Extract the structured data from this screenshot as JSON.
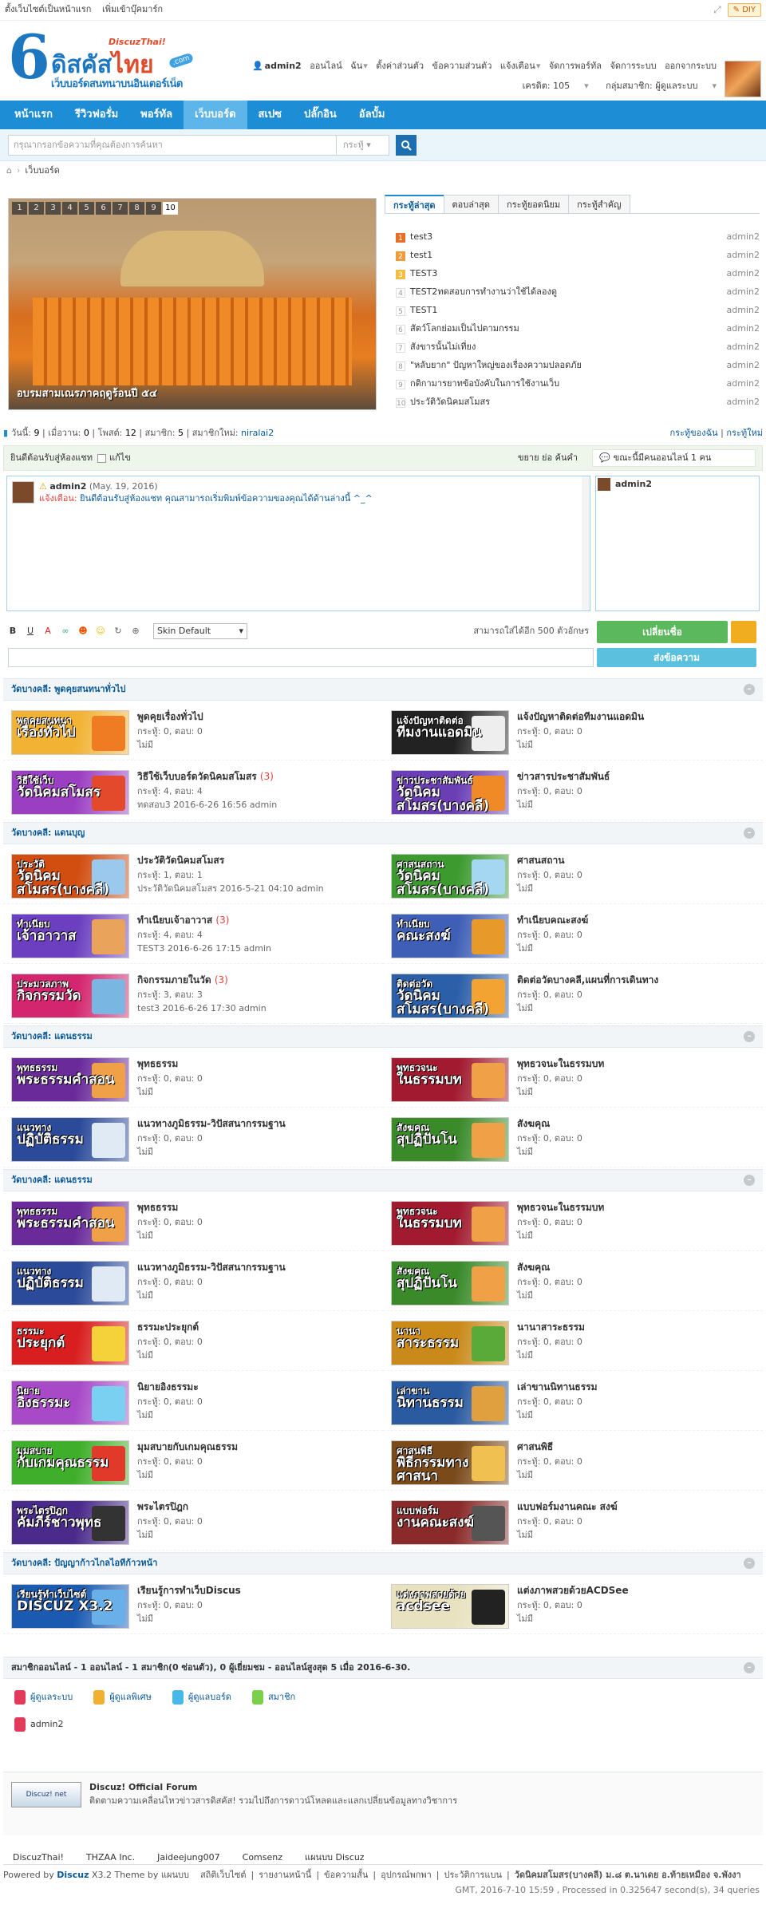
{
  "topbar": {
    "set_home": "ตั้งเว็บไซต์เป็นหน้าแรก",
    "bookmark": "เพิ่มเข้าบุ๊คมาร์ก",
    "diy": "DIY"
  },
  "logo": {
    "digit": "6",
    "title_a": "ดิสคัส",
    "title_b": "ไทย",
    "subtitle": "เว็บบอร์ดสนทนาบนอินเตอร์เน็ต",
    "tag": "DiscuzThai!",
    "com": ".com"
  },
  "user": {
    "name": "admin2",
    "online": "ออนไลน์",
    "menu": [
      "ฉัน",
      "ตั้งค่าส่วนตัว",
      "ข้อความส่วนตัว",
      "แจ้งเตือน",
      "จัดการพอร์ทัล",
      "จัดการระบบ",
      "ออกจากระบบ"
    ],
    "credit": "เครดิต: 105",
    "group": "กลุ่มสมาชิก: ผู้ดูแลระบบ"
  },
  "nav": [
    "หน้าแรก",
    "รีวิวฟอรั่ม",
    "พอร์ทัล",
    "เว็บบอร์ด",
    "สเปซ",
    "ปลั๊กอิน",
    "อัลบั้ม"
  ],
  "search": {
    "placeholder": "กรุณากรอกข้อความที่คุณต้องการค้นหา",
    "scope": "กระทู้"
  },
  "breadcrumb": "เว็บบอร์ด",
  "slideshow": {
    "pages": [
      "1",
      "2",
      "3",
      "4",
      "5",
      "6",
      "7",
      "8",
      "9",
      "10"
    ],
    "active": "10",
    "caption": "อบรมสามเณรภาคฤดูร้อนปี ๕๔"
  },
  "tabs": [
    "กระทู้ล่าสุด",
    "ตอบล่าสุด",
    "กระทู้ยอดนิยม",
    "กระทู้สำคัญ"
  ],
  "latest": [
    {
      "n": "1",
      "title": "test3",
      "author": "admin2"
    },
    {
      "n": "2",
      "title": "test1",
      "author": "admin2"
    },
    {
      "n": "3",
      "title": "TEST3",
      "author": "admin2"
    },
    {
      "n": "4",
      "title": "TEST2ทดสอบการทำงานว่าใช้ได้ลองดู",
      "author": "admin2"
    },
    {
      "n": "5",
      "title": "TEST1",
      "author": "admin2"
    },
    {
      "n": "6",
      "title": "สัตว์โลกย่อมเป็นไปตามกรรม",
      "author": "admin2"
    },
    {
      "n": "7",
      "title": "สังขารนั้นไม่เที่ยง",
      "author": "admin2"
    },
    {
      "n": "8",
      "title": "\"หลับยาก\" ปัญหาใหญ่ของเรื่องความปลอดภัย",
      "author": "admin2"
    },
    {
      "n": "9",
      "title": "กติกามารยาทข้อบังคับในการใช้งานเว็บ",
      "author": "admin2"
    },
    {
      "n": "10",
      "title": "ประวัติวัดนิคมสโมสร",
      "author": "admin2"
    }
  ],
  "stats": {
    "today_l": "วันนี้:",
    "today": "9",
    "yesterday_l": "เมื่อวาน:",
    "yesterday": "0",
    "posts_l": "โพสต์:",
    "posts": "12",
    "members_l": "สมาชิก:",
    "members": "5",
    "newest_l": "สมาชิกใหม่:",
    "newest": "niralai2",
    "my_threads": "กระทู้ของฉัน",
    "my_posts": "กระทู้ใหม่"
  },
  "chat": {
    "welcome": "ยินดีต้อนรับสู่ห้องแชท",
    "fix": "แก้ไข",
    "size": "ขยาย ย่อ ค้นคำ",
    "online": "ขณะนี้มีคนออนไลน์ 1 คน",
    "msg_user": "admin2",
    "msg_date": "(May. 19, 2016)",
    "msg_label": "แจ้งเตือน:",
    "msg_text": "ยินดีต้อนรับสู่ห้องแชท คุณสามารถเริ่มพิมพ์ข้อความของคุณได้ด้านล่างนี้ ^_^",
    "online_user": "admin2",
    "skin": "Skin Default",
    "remain": "สามารถใส่ได้อีก 500 ตัวอักษร",
    "change_name": "เปลี่ยนชื่อ",
    "send": "ส่งข้อความ"
  },
  "sections": [
    {
      "title": "วัดบางคลี: พูดคุยสนทนาทั่วไป",
      "forums": [
        {
          "name": "พูดคุยเรื่องทั่วไป",
          "new": "",
          "meta1": "กระทู้: 0, ตอบ: 0",
          "meta2": "ไม่มี",
          "b1": "พูดคุยสนทนา",
          "b2": "เรื่องทั่วไป",
          "bg": "#f2b233",
          "art": "#ef7b22"
        },
        {
          "name": "แจ้งปัญหาติดต่อทีมงานแอดมิน",
          "new": "",
          "meta1": "กระทู้: 0, ตอบ: 0",
          "meta2": "ไม่มี",
          "b1": "แจ้งปัญหาติดต่อ",
          "b2": "ทีมงานแอดมิน",
          "bg": "#222",
          "art": "#eee"
        },
        {
          "name": "วิธีใช้เว็บบอร์ดวัดนิคมสโมสร",
          "new": "(3)",
          "meta1": "กระทู้: 4, ตอบ: 4",
          "meta2": "ทดสอบ3 2016-6-26 16:56 admin",
          "b1": "วิธีใช้เว็บ",
          "b2": "วัดนิคมสโมสร",
          "bg": "#9b3fc2",
          "art": "#e24a2b"
        },
        {
          "name": "ข่าวสารประชาสัมพันธ์",
          "new": "",
          "meta1": "กระทู้: 0, ตอบ: 0",
          "meta2": "ไม่มี",
          "b1": "ข่าวประชาสัมพันธ์",
          "b2": "วัดนิคมสโมสร(บางคลี)",
          "bg": "#6a3fb5",
          "art": "#ef8a26"
        }
      ]
    },
    {
      "title": "วัดบางคลี: แดนบุญ",
      "forums": [
        {
          "name": "ประวัติวัดนิคมสโมสร",
          "new": "",
          "meta1": "กระทู้: 1, ตอบ: 1",
          "meta2": "ประวัติวัดนิคมสโมสร 2016-5-21 04:10 admin",
          "b1": "ประวัติ",
          "b2": "วัดนิคมสโมสร(บางคลี)",
          "bg": "#d14d10",
          "art": "#9bc9ee"
        },
        {
          "name": "ศาสนสถาน",
          "new": "",
          "meta1": "กระทู้: 0, ตอบ: 0",
          "meta2": "ไม่มี",
          "b1": "ศาสนสถาน",
          "b2": "วัดนิคมสโมสร(บางคลี)",
          "bg": "#3c9a2f",
          "art": "#a6d7f2"
        },
        {
          "name": "ทำเนียบเจ้าอาวาส",
          "new": "(3)",
          "meta1": "กระทู้: 4, ตอบ: 4",
          "meta2": "TEST3 2016-6-26 17:15 admin",
          "b1": "ทำเนียบ",
          "b2": "เจ้าอาวาส",
          "bg": "#6b3fc0",
          "art": "#e9a35a"
        },
        {
          "name": "ทำเนียบคณะสงฆ์",
          "new": "",
          "meta1": "กระทู้: 0, ตอบ: 0",
          "meta2": "ไม่มี",
          "b1": "ทำเนียบ",
          "b2": "คณะสงฆ์",
          "bg": "#3f5fb6",
          "art": "#e79a2a"
        },
        {
          "name": "กิจกรรมภายในวัด",
          "new": "(3)",
          "meta1": "กระทู้: 3, ตอบ: 3",
          "meta2": "test3 2016-6-26 17:30 admin",
          "b1": "ประมวลภาพ",
          "b2": "กิจกรรมวัด",
          "bg": "#d4266e",
          "art": "#7ab6e2"
        },
        {
          "name": "ติดต่อวัดบางคลี,แผนที่การเดินทาง",
          "new": "",
          "meta1": "กระทู้: 0, ตอบ: 0",
          "meta2": "ไม่มี",
          "b1": "ติดต่อวัด",
          "b2": "วัดนิคมสโมสร(บางคลี)",
          "bg": "#2b5fa8",
          "art": "#f2a331"
        }
      ]
    },
    {
      "title": "วัดบางคลี: แดนธรรม",
      "forums": [
        {
          "name": "พุทธธรรม",
          "new": "",
          "meta1": "กระทู้: 0, ตอบ: 0",
          "meta2": "ไม่มี",
          "b1": "พุทธธรรม",
          "b2": "พระธรรมคำสอน",
          "bg": "#6a2a9a",
          "art": "#f0a046"
        },
        {
          "name": "พุทธวจนะในธรรมบท",
          "new": "",
          "meta1": "กระทู้: 0, ตอบ: 0",
          "meta2": "ไม่มี",
          "b1": "พุทธวจนะ",
          "b2": "ในธรรมบท",
          "bg": "#a11a2f",
          "art": "#f0a046"
        },
        {
          "name": "แนวทางภูมิธรรม-วิปัสสนากรรมฐาน",
          "new": "",
          "meta1": "กระทู้: 0, ตอบ: 0",
          "meta2": "ไม่มี",
          "b1": "แนวทาง",
          "b2": "ปฏิบัติธรรม",
          "bg": "#2b4a9a",
          "art": "#dfeaf5"
        },
        {
          "name": "สังฆคุณ",
          "new": "",
          "meta1": "กระทู้: 0, ตอบ: 0",
          "meta2": "ไม่มี",
          "b1": "สังฆคุณ",
          "b2": "สุปฏิปันโน",
          "bg": "#3a8a2a",
          "art": "#f0a046"
        }
      ]
    },
    {
      "title": "วัดบางคลี: แดนธรรม",
      "forums": [
        {
          "name": "พุทธธรรม",
          "new": "",
          "meta1": "กระทู้: 0, ตอบ: 0",
          "meta2": "ไม่มี",
          "b1": "พุทธธรรม",
          "b2": "พระธรรมคำสอน",
          "bg": "#6a2a9a",
          "art": "#f0a046"
        },
        {
          "name": "พุทธวจนะในธรรมบท",
          "new": "",
          "meta1": "กระทู้: 0, ตอบ: 0",
          "meta2": "ไม่มี",
          "b1": "พุทธวจนะ",
          "b2": "ในธรรมบท",
          "bg": "#a11a2f",
          "art": "#f0a046"
        },
        {
          "name": "แนวทางภูมิธรรม-วิปัสสนากรรมฐาน",
          "new": "",
          "meta1": "กระทู้: 0, ตอบ: 0",
          "meta2": "ไม่มี",
          "b1": "แนวทาง",
          "b2": "ปฏิบัติธรรม",
          "bg": "#2b4a9a",
          "art": "#dfeaf5"
        },
        {
          "name": "สังฆคุณ",
          "new": "",
          "meta1": "กระทู้: 0, ตอบ: 0",
          "meta2": "ไม่มี",
          "b1": "สังฆคุณ",
          "b2": "สุปฏิปันโน",
          "bg": "#3a8a2a",
          "art": "#f0a046"
        },
        {
          "name": "ธรรมะประยุกต์",
          "new": "",
          "meta1": "กระทู้: 0, ตอบ: 0",
          "meta2": "ไม่มี",
          "b1": "ธรรมะ",
          "b2": "ประยุกต์",
          "bg": "#d81e1e",
          "art": "#f5d23a"
        },
        {
          "name": "นานาสาระธรรม",
          "new": "",
          "meta1": "กระทู้: 0, ตอบ: 0",
          "meta2": "ไม่มี",
          "b1": "นานา",
          "b2": "สาระธรรม",
          "bg": "#c98a1a",
          "art": "#5aaa3a"
        },
        {
          "name": "นิยายอิงธรรมะ",
          "new": "",
          "meta1": "กระทู้: 0, ตอบ: 0",
          "meta2": "ไม่มี",
          "b1": "นิยาย",
          "b2": "อิงธรรมะ",
          "bg": "#a84ac8",
          "art": "#7ad0f0"
        },
        {
          "name": "เล่าขานนิทานธรรม",
          "new": "",
          "meta1": "กระทู้: 0, ตอบ: 0",
          "meta2": "ไม่มี",
          "b1": "เล่าขาน",
          "b2": "นิทานธรรม",
          "bg": "#2a5aa0",
          "art": "#e0a040"
        },
        {
          "name": "มุมสบายกับเกมคุณธรรม",
          "new": "",
          "meta1": "กระทู้: 0, ตอบ: 0",
          "meta2": "ไม่มี",
          "b1": "มุมสบาย",
          "b2": "กับเกมคุณธรรม",
          "bg": "#3fae2a",
          "art": "#e23a2a"
        },
        {
          "name": "ศาสนพิธี",
          "new": "",
          "meta1": "กระทู้: 0, ตอบ: 0",
          "meta2": "ไม่มี",
          "b1": "ศาสนพิธี",
          "b2": "พิธีกรรมทางศาสนา",
          "bg": "#7a4a1a",
          "art": "#f0c050"
        },
        {
          "name": "พระไตรปิฎก",
          "new": "",
          "meta1": "กระทู้: 0, ตอบ: 0",
          "meta2": "ไม่มี",
          "b1": "พระไตรปิฎก",
          "b2": "คัมภีร์ชาวพุทธ",
          "bg": "#4a2a8a",
          "art": "#333"
        },
        {
          "name": "แบบฟอร์มงานคณะ สงฆ์",
          "new": "",
          "meta1": "กระทู้: 0, ตอบ: 0",
          "meta2": "ไม่มี",
          "b1": "แบบฟอร์ม",
          "b2": "งานคณะสงฆ์",
          "bg": "#8a2a2a",
          "art": "#555"
        }
      ]
    },
    {
      "title": "วัดบางคลี: ปัญญาก้าวไกลไอทีก้าวหน้า",
      "forums": [
        {
          "name": "เรียนรู้การทำเว็บDiscus",
          "new": "",
          "meta1": "กระทู้: 0, ตอบ: 0",
          "meta2": "ไม่มี",
          "b1": "เรียนรู้ทำเว็บไซต์",
          "b2": "DISCUZ X3.2",
          "bg": "#1a5ab0",
          "art": "#6ab0e8"
        },
        {
          "name": "แต่งภาพสวยด้วยACDSee",
          "new": "",
          "meta1": "กระทู้: 0, ตอบ: 0",
          "meta2": "ไม่มี",
          "b1": "แต่งภาพสวยด้วย",
          "b2": "acdsee",
          "bg": "#e8e2c0",
          "art": "#222"
        }
      ]
    }
  ],
  "online": {
    "title": "สมาชิกออนไลน์ - 1 ออนไลน์ - 1 สมาชิก(0 ซ่อนตัว), 0 ผู้เยี่ยมชม - ออนไลน์สูงสุด 5 เมื่อ 2016-6-30.",
    "legend": [
      "ผู้ดูแลระบบ",
      "ผู้ดูแลพิเศษ",
      "ผู้ดูแลบอร์ด",
      "สมาชิก"
    ],
    "user": "admin2"
  },
  "official": {
    "title": "Discuz! Official Forum",
    "desc": "ติดตามความเคลื่อนไหวข่าวสารดิสคัส! รวมไปถึงการดาวน์โหลดและแลกเปลี่ยนข้อมูลทางวิชาการ",
    "logo": "Discuz! net"
  },
  "friend_links": [
    "DiscuzThai!",
    "THZAA Inc.",
    "Jaideejung007",
    "Comsenz",
    "แผนบบ Discuz"
  ],
  "footer": {
    "powered": "Powered by",
    "discuz": "Discuz",
    "ver": "X3.2 Theme by แผนบบ",
    "links": [
      "สถิติเว็บไซต์",
      "รายงานหน้านี้",
      "ข้อความสั้น",
      "อุปกรณ์พกพา",
      "ประวัติการแบน"
    ],
    "org": "วัดนิคมสโมสร(บางคลี) ม.๘ ต.นาเดย อ.ท้ายเหมือง จ.พังงา",
    "time": "GMT, 2016-7-10 15:59 , Processed in 0.325647 second(s), 34 queries"
  },
  "colors": {
    "nav": "#1d8ed6",
    "nav_active": "#5db5ea",
    "link": "#0b5a99",
    "accent": "#e0443a"
  }
}
